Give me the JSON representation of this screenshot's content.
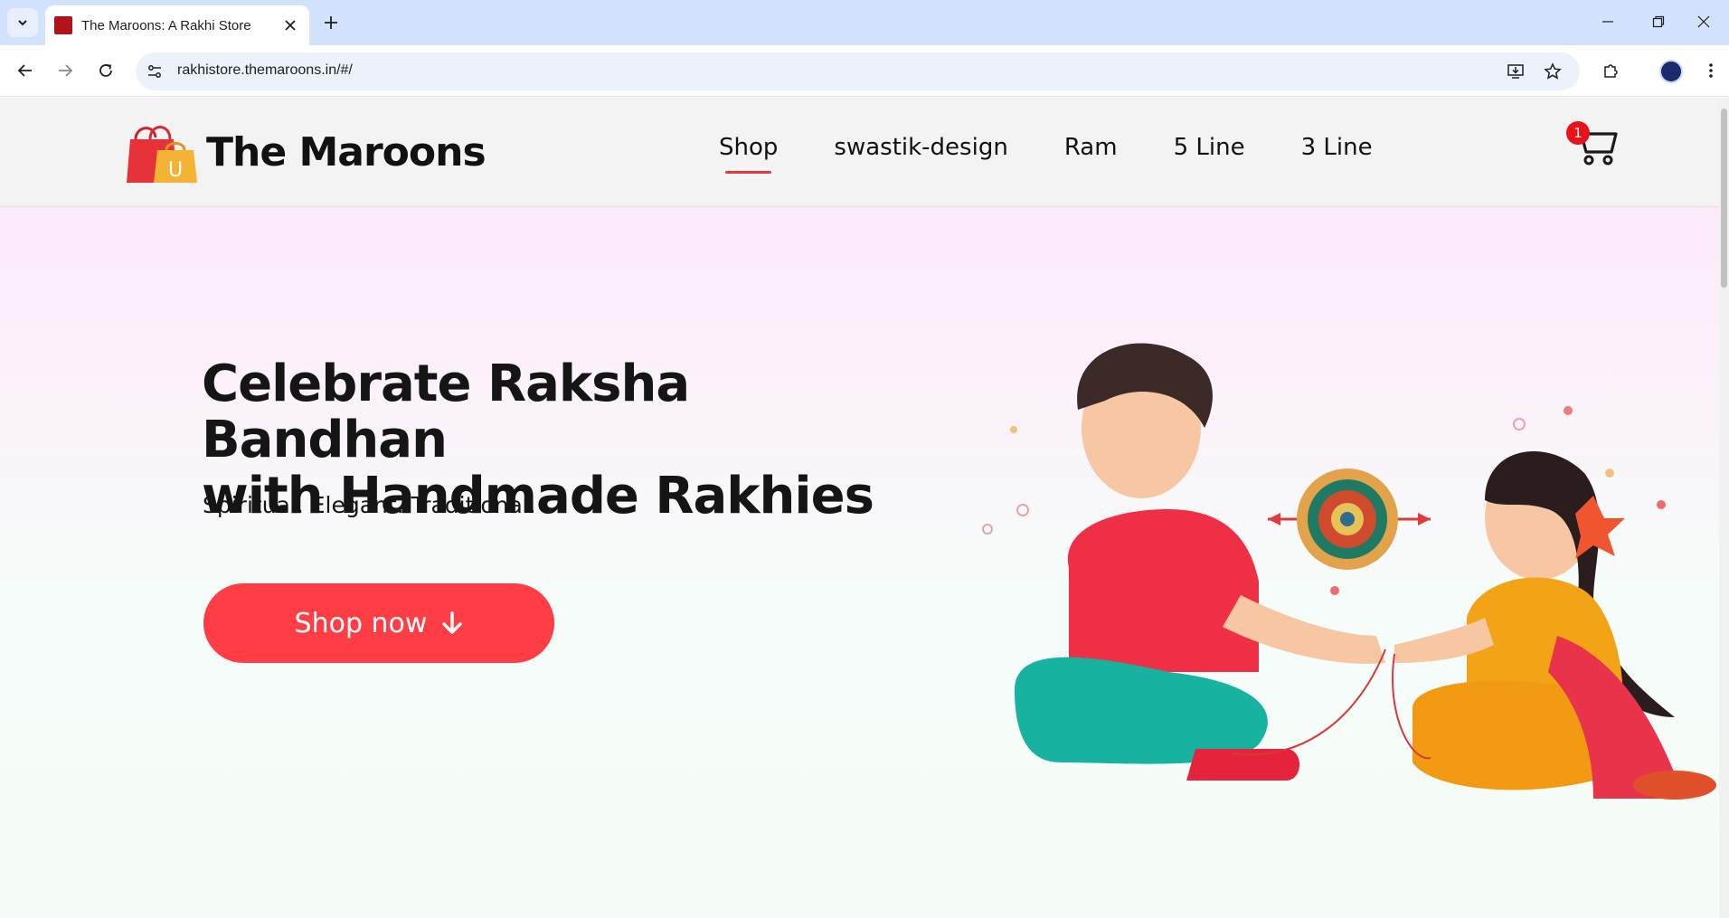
{
  "browser": {
    "tab_title": "The Maroons: A Rakhi Store",
    "url": "rakhistore.themaroons.in/#/"
  },
  "site": {
    "logo_text": "The Maroons",
    "logo_bag_letter": "U",
    "nav": [
      "Shop",
      "swastik-design",
      "Ram",
      "5 Line",
      "3 Line"
    ],
    "active_nav": "Shop",
    "cart_count": "1"
  },
  "hero": {
    "title_line1": "Celebrate Raksha Bandhan",
    "title_line2": "with Handmade Rakhies",
    "subtitle": "Spiritual. Elegant. Traditional.",
    "cta_label": "Shop now",
    "cta_icon": "arrow-down-icon",
    "illustration": "brother-sister-rakhi-illustration"
  },
  "colors": {
    "accent": "#fe3e44",
    "badge": "#e8121b",
    "tabstrip": "#d3e3fd"
  }
}
